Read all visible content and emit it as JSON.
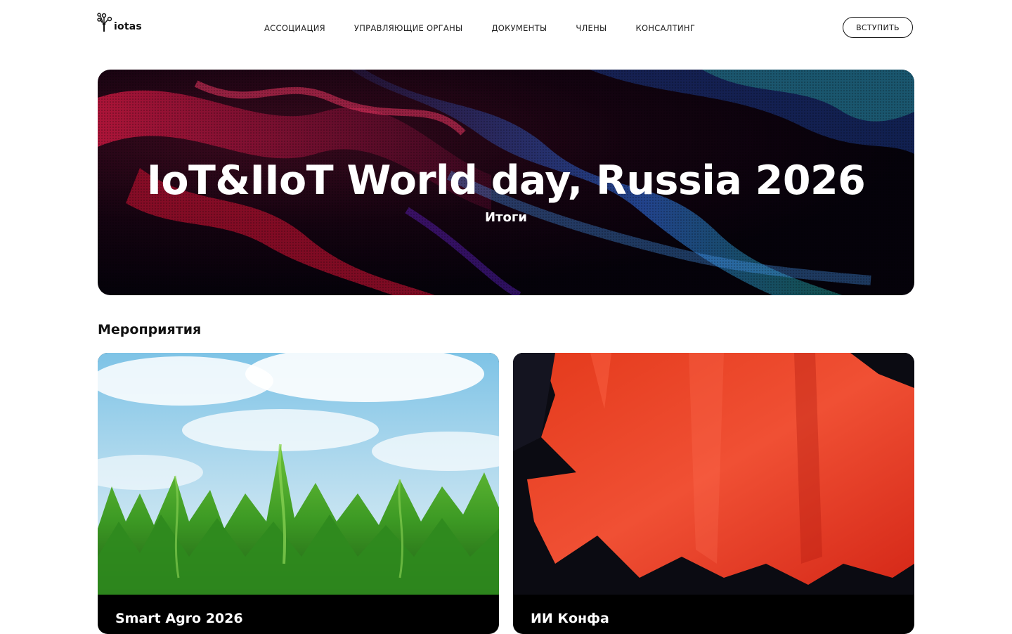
{
  "logo": {
    "text": "iotas"
  },
  "nav": {
    "items": [
      {
        "label": "АССОЦИАЦИЯ"
      },
      {
        "label": "УПРАВЛЯЮЩИЕ ОРГАНЫ"
      },
      {
        "label": "ДОКУМЕНТЫ"
      },
      {
        "label": "ЧЛЕНЫ"
      },
      {
        "label": "КОНСАЛТИНГ"
      }
    ],
    "join_label": "ВСТУПИТЬ"
  },
  "hero": {
    "title": "IoT&IIoT World day, Russia 2026",
    "subtitle": "Итоги"
  },
  "events": {
    "heading": "Мероприятия",
    "cards": [
      {
        "title": "Smart Agro 2026"
      },
      {
        "title": "ИИ Конфа"
      }
    ]
  },
  "colors": {
    "text": "#111111",
    "background": "#ffffff",
    "hero_red": "#c0143c",
    "hero_blue": "#1e4fb4",
    "card2_red": "#e8341e"
  }
}
